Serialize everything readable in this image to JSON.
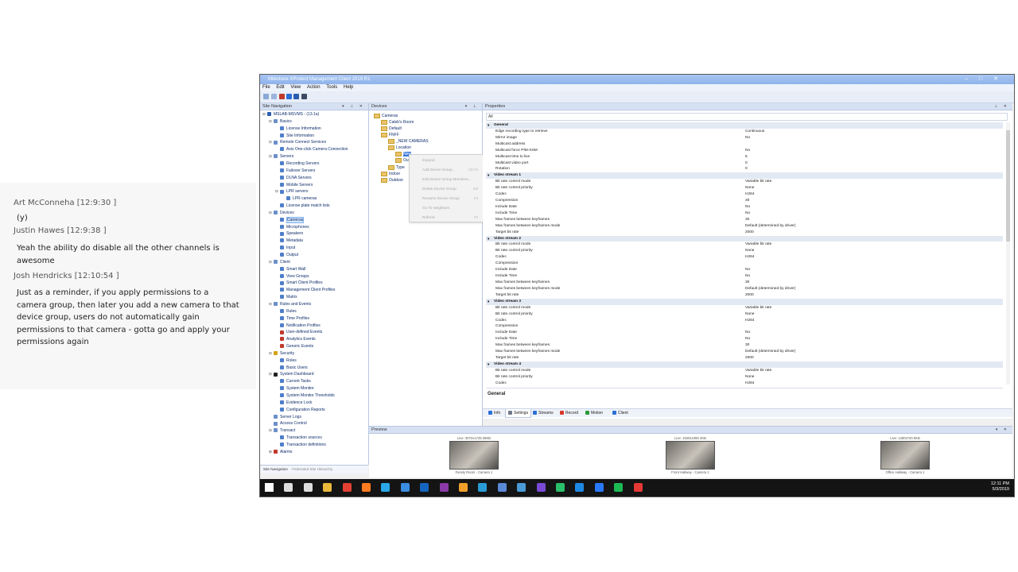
{
  "chat": {
    "messages": [
      {
        "author": "Art McConneha [12:9:30 ]",
        "text": "(y)"
      },
      {
        "author": "Justin Hawes [12:9:38 ]",
        "text": "Yeah the ability do disable all the other channels is awesome"
      },
      {
        "author": "Josh Hendricks [12:10:54 ]",
        "text": "Just as a reminder, if you apply permissions to a camera group, then later you add a new camera to that device group, users do not automatically gain permissions to that camera - gotta go and apply your permissions again"
      }
    ]
  },
  "window": {
    "title": "Milestone XProtect Management Client 2019 R1",
    "controls": [
      "–",
      "□",
      "✕"
    ],
    "menu": [
      "File",
      "Edit",
      "View",
      "Action",
      "Tools",
      "Help"
    ]
  },
  "site_navigation": {
    "header": "Site Navigation",
    "items": [
      {
        "label": "MSLAB-MSVMS - (13.1a)",
        "level": 0,
        "exp": "⊟",
        "color": "#2a5db0"
      },
      {
        "label": "Basics",
        "level": 1,
        "exp": "⊟",
        "color": "#6b8fc8"
      },
      {
        "label": "License Information",
        "level": 2,
        "exp": "",
        "color": "#4f7fca"
      },
      {
        "label": "Site Information",
        "level": 2,
        "exp": "",
        "color": "#4f7fca"
      },
      {
        "label": "Remote Connect Services",
        "level": 1,
        "exp": "⊟",
        "color": "#6b8fc8"
      },
      {
        "label": "Axis One-click Camera Connection",
        "level": 2,
        "exp": "",
        "color": "#4f7fca"
      },
      {
        "label": "Servers",
        "level": 1,
        "exp": "⊟",
        "color": "#6b8fc8"
      },
      {
        "label": "Recording Servers",
        "level": 2,
        "exp": "",
        "color": "#4f7fca"
      },
      {
        "label": "Failover Servers",
        "level": 2,
        "exp": "",
        "color": "#4f7fca"
      },
      {
        "label": "DLNA Servers",
        "level": 2,
        "exp": "",
        "color": "#4f7fca"
      },
      {
        "label": "Mobile Servers",
        "level": 2,
        "exp": "",
        "color": "#4f7fca"
      },
      {
        "label": "LPR servers",
        "level": 2,
        "exp": "⊟",
        "color": "#4f7fca"
      },
      {
        "label": "LPR cameras",
        "level": 3,
        "exp": "",
        "color": "#4f7fca"
      },
      {
        "label": "License plate match lists",
        "level": 2,
        "exp": "",
        "color": "#4f7fca"
      },
      {
        "label": "Devices",
        "level": 1,
        "exp": "⊟",
        "color": "#6b8fc8"
      },
      {
        "label": "Cameras",
        "level": 2,
        "exp": "",
        "color": "#4f7fca",
        "selected": true
      },
      {
        "label": "Microphones",
        "level": 2,
        "exp": "",
        "color": "#4f7fca"
      },
      {
        "label": "Speakers",
        "level": 2,
        "exp": "",
        "color": "#4f7fca"
      },
      {
        "label": "Metadata",
        "level": 2,
        "exp": "",
        "color": "#4f7fca"
      },
      {
        "label": "Input",
        "level": 2,
        "exp": "",
        "color": "#4f7fca"
      },
      {
        "label": "Output",
        "level": 2,
        "exp": "",
        "color": "#4f7fca"
      },
      {
        "label": "Client",
        "level": 1,
        "exp": "⊟",
        "color": "#6b8fc8"
      },
      {
        "label": "Smart Wall",
        "level": 2,
        "exp": "",
        "color": "#4f7fca"
      },
      {
        "label": "View Groups",
        "level": 2,
        "exp": "",
        "color": "#4f7fca"
      },
      {
        "label": "Smart Client Profiles",
        "level": 2,
        "exp": "",
        "color": "#4f7fca"
      },
      {
        "label": "Management Client Profiles",
        "level": 2,
        "exp": "",
        "color": "#4f7fca"
      },
      {
        "label": "Matrix",
        "level": 2,
        "exp": "",
        "color": "#4f7fca"
      },
      {
        "label": "Rules and Events",
        "level": 1,
        "exp": "⊟",
        "color": "#6b8fc8"
      },
      {
        "label": "Rules",
        "level": 2,
        "exp": "",
        "color": "#4f7fca"
      },
      {
        "label": "Time Profiles",
        "level": 2,
        "exp": "",
        "color": "#4f7fca"
      },
      {
        "label": "Notification Profiles",
        "level": 2,
        "exp": "",
        "color": "#4f7fca"
      },
      {
        "label": "User-defined Events",
        "level": 2,
        "exp": "",
        "color": "#c0392b"
      },
      {
        "label": "Analytics Events",
        "level": 2,
        "exp": "",
        "color": "#c0392b"
      },
      {
        "label": "Generic Events",
        "level": 2,
        "exp": "",
        "color": "#c0392b"
      },
      {
        "label": "Security",
        "level": 1,
        "exp": "⊟",
        "color": "#d4a017"
      },
      {
        "label": "Roles",
        "level": 2,
        "exp": "",
        "color": "#4f7fca"
      },
      {
        "label": "Basic Users",
        "level": 2,
        "exp": "",
        "color": "#4f7fca"
      },
      {
        "label": "System Dashboard",
        "level": 1,
        "exp": "⊟",
        "color": "#222222"
      },
      {
        "label": "Current Tasks",
        "level": 2,
        "exp": "",
        "color": "#4f7fca"
      },
      {
        "label": "System Monitor",
        "level": 2,
        "exp": "",
        "color": "#4f7fca"
      },
      {
        "label": "System Monitor Thresholds",
        "level": 2,
        "exp": "",
        "color": "#4f7fca"
      },
      {
        "label": "Evidence Lock",
        "level": 2,
        "exp": "",
        "color": "#4f7fca"
      },
      {
        "label": "Configuration Reports",
        "level": 2,
        "exp": "",
        "color": "#4f7fca"
      },
      {
        "label": "Server Logs",
        "level": 1,
        "exp": "",
        "color": "#6b8fc8"
      },
      {
        "label": "Access Control",
        "level": 1,
        "exp": "",
        "color": "#6b8fc8"
      },
      {
        "label": "Transact",
        "level": 1,
        "exp": "⊟",
        "color": "#6b8fc8"
      },
      {
        "label": "Transaction sources",
        "level": 2,
        "exp": "",
        "color": "#4f7fca"
      },
      {
        "label": "Transaction definitions",
        "level": 2,
        "exp": "",
        "color": "#4f7fca"
      },
      {
        "label": "Alarms",
        "level": 1,
        "exp": "⊞",
        "color": "#c0392b"
      }
    ],
    "bottom_tabs": [
      "Site Navigation",
      "Federated Site Hierarchy"
    ]
  },
  "devices": {
    "header": "Devices",
    "tree": [
      {
        "label": "Cameras",
        "level": 0
      },
      {
        "label": "Caleb's Room",
        "level": 1
      },
      {
        "label": "Default",
        "level": 1
      },
      {
        "label": "FNFF",
        "level": 1
      },
      {
        "label": "_NEW CAMERAS",
        "level": 2
      },
      {
        "label": "Location",
        "level": 2
      },
      {
        "label": "New",
        "level": 3
      },
      {
        "label": "Outdoor",
        "level": 3
      },
      {
        "label": "Type",
        "level": 2
      },
      {
        "label": "Indoor",
        "level": 1
      },
      {
        "label": "Outdoor",
        "level": 1
      }
    ]
  },
  "context_menu": {
    "items": [
      {
        "label": "Expand",
        "key": ""
      },
      {
        "label": "Add Device Group...",
        "key": "Ctrl+N"
      },
      {
        "label": "Edit Device Group Members...",
        "key": ""
      },
      {
        "label": "Delete Device Group",
        "key": "Del"
      },
      {
        "label": "Rename Device Group",
        "key": "F2"
      },
      {
        "label": "Go To Neighbors",
        "key": ""
      },
      {
        "label": "Refresh",
        "key": "F5"
      }
    ]
  },
  "properties": {
    "header": "Properties",
    "filter": "All",
    "rows": [
      {
        "key": "General",
        "value": "",
        "section": true
      },
      {
        "key": "Edge recording type to retrieve",
        "value": "Continuous"
      },
      {
        "key": "Mirror image",
        "value": "No"
      },
      {
        "key": "Multicast address",
        "value": ""
      },
      {
        "key": "Multicast force PIM-SSM",
        "value": "No"
      },
      {
        "key": "Multicast time to live",
        "value": "5"
      },
      {
        "key": "Multicast video port",
        "value": "0"
      },
      {
        "key": "Rotation",
        "value": "0"
      },
      {
        "key": "Video stream 1",
        "value": "",
        "section": true
      },
      {
        "key": "Bit rate control mode",
        "value": "Variable bit rate"
      },
      {
        "key": "Bit rate control priority",
        "value": "None"
      },
      {
        "key": "Codec",
        "value": "H264"
      },
      {
        "key": "Compression",
        "value": "30"
      },
      {
        "key": "Include Date",
        "value": "No"
      },
      {
        "key": "Include Time",
        "value": "No"
      },
      {
        "key": "Max frames between keyframes",
        "value": "30"
      },
      {
        "key": "Max frames between keyframes mode",
        "value": "Default (determined by driver)"
      },
      {
        "key": "Target bit rate",
        "value": "2000"
      },
      {
        "key": "Video stream 2",
        "value": "",
        "section": true
      },
      {
        "key": "Bit rate control mode",
        "value": "Variable bit rate"
      },
      {
        "key": "Bit rate control priority",
        "value": "None"
      },
      {
        "key": "Codec",
        "value": "H264"
      },
      {
        "key": "Compression",
        "value": ""
      },
      {
        "key": "Include Date",
        "value": "No"
      },
      {
        "key": "Include Time",
        "value": "No"
      },
      {
        "key": "Max frames between keyframes",
        "value": "30"
      },
      {
        "key": "Max frames between keyframes mode",
        "value": "Default (determined by driver)"
      },
      {
        "key": "Target bit rate",
        "value": "2000"
      },
      {
        "key": "Video stream 3",
        "value": "",
        "section": true
      },
      {
        "key": "Bit rate control mode",
        "value": "Variable bit rate"
      },
      {
        "key": "Bit rate control priority",
        "value": "None"
      },
      {
        "key": "Codec",
        "value": "H264"
      },
      {
        "key": "Compression",
        "value": ""
      },
      {
        "key": "Include Date",
        "value": "No"
      },
      {
        "key": "Include Time",
        "value": "No"
      },
      {
        "key": "Max frames between keyframes",
        "value": "30"
      },
      {
        "key": "Max frames between keyframes mode",
        "value": "Default (determined by driver)"
      },
      {
        "key": "Target bit rate",
        "value": "2000"
      },
      {
        "key": "Video stream 4",
        "value": "",
        "section": true
      },
      {
        "key": "Bit rate control mode",
        "value": "Variable bit rate"
      },
      {
        "key": "Bit rate control priority",
        "value": "None"
      },
      {
        "key": "Codec",
        "value": "H264"
      }
    ],
    "description_title": "General",
    "tabs": [
      {
        "label": "Info",
        "color": "#2a6fd6"
      },
      {
        "label": "Settings",
        "color": "#6f7b8a",
        "active": true
      },
      {
        "label": "Streams",
        "color": "#2a6fd6"
      },
      {
        "label": "Record",
        "color": "#d63a2a"
      },
      {
        "label": "Motion",
        "color": "#2a9a3a"
      },
      {
        "label": "Client",
        "color": "#2a6fd6"
      }
    ]
  },
  "preview": {
    "header": "Preview",
    "cameras": [
      {
        "stats": "Live: 3072x1728 28KB",
        "name": "Family Room - Camera 1"
      },
      {
        "stats": "Live: 1920x1080 4KB",
        "name": "Front Hallway - Camera 1"
      },
      {
        "stats": "Live: 1280x720 5KB",
        "name": "Office Hallway - Camera 1"
      }
    ]
  },
  "taskbar": {
    "time": "12:11 PM",
    "date": "5/3/2019",
    "icons": [
      {
        "name": "start-icon",
        "color": "#ffffff"
      },
      {
        "name": "search-icon",
        "color": "#dddddd"
      },
      {
        "name": "task-view-icon",
        "color": "#dddddd"
      },
      {
        "name": "file-explorer-icon",
        "color": "#e8b93a"
      },
      {
        "name": "chrome-icon",
        "color": "#e34133"
      },
      {
        "name": "firefox-icon",
        "color": "#ff7b22"
      },
      {
        "name": "skype-icon",
        "color": "#2aa7e8"
      },
      {
        "name": "pen-icon",
        "color": "#3a8de0"
      },
      {
        "name": "outlook-icon",
        "color": "#1565c0"
      },
      {
        "name": "onenote-icon",
        "color": "#8b3aa8"
      },
      {
        "name": "app-orange-icon",
        "color": "#f0a02a"
      },
      {
        "name": "edge-icon",
        "color": "#2a9ad6"
      },
      {
        "name": "xprotect-icon",
        "color": "#5a8ad6"
      },
      {
        "name": "settings-icon",
        "color": "#4a9ad6"
      },
      {
        "name": "app-purple-icon",
        "color": "#7a4ad6"
      },
      {
        "name": "app-green-icon",
        "color": "#2abf6a"
      },
      {
        "name": "vscode-icon",
        "color": "#1e88e5"
      },
      {
        "name": "app-blue-icon",
        "color": "#2979ff"
      },
      {
        "name": "spotify-icon",
        "color": "#1db954"
      },
      {
        "name": "acrobat-icon",
        "color": "#e53935"
      }
    ]
  }
}
